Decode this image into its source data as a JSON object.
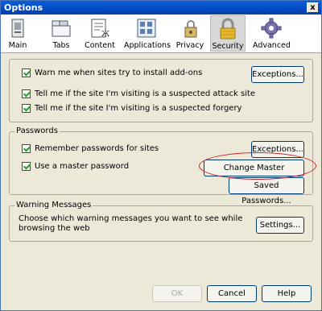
{
  "window": {
    "title": "Options",
    "close_glyph": "x"
  },
  "toolbar": {
    "items": [
      {
        "label": "Main",
        "icon": "main-icon"
      },
      {
        "label": "Tabs",
        "icon": "tabs-icon"
      },
      {
        "label": "Content",
        "icon": "content-icon"
      },
      {
        "label": "Applications",
        "icon": "applications-icon"
      },
      {
        "label": "Privacy",
        "icon": "privacy-icon"
      },
      {
        "label": "Security",
        "icon": "padlock-icon",
        "selected": true
      },
      {
        "label": "Advanced",
        "icon": "gear-icon"
      }
    ]
  },
  "security": {
    "addons_warning_label": "Warn me when sites try to install add-ons",
    "addons_exceptions_label": "Exceptions...",
    "attack_site_label": "Tell me if the site I'm visiting is a suspected attack site",
    "forgery_label": "Tell me if the site I'm visiting is a suspected forgery"
  },
  "passwords": {
    "group_label": "Passwords",
    "remember_label": "Remember passwords for sites",
    "exceptions_label": "Exceptions...",
    "master_label": "Use a master password",
    "change_master_label": "Change Master Password...",
    "saved_passwords_label": "Saved Passwords..."
  },
  "warnings": {
    "group_label": "Warning Messages",
    "description": "Choose which warning messages you want to see while browsing the web",
    "settings_label": "Settings..."
  },
  "footer": {
    "ok_label": "OK",
    "cancel_label": "Cancel",
    "help_label": "Help"
  },
  "colors": {
    "titlebar": "#0449c0",
    "annotation": "#d02020"
  }
}
